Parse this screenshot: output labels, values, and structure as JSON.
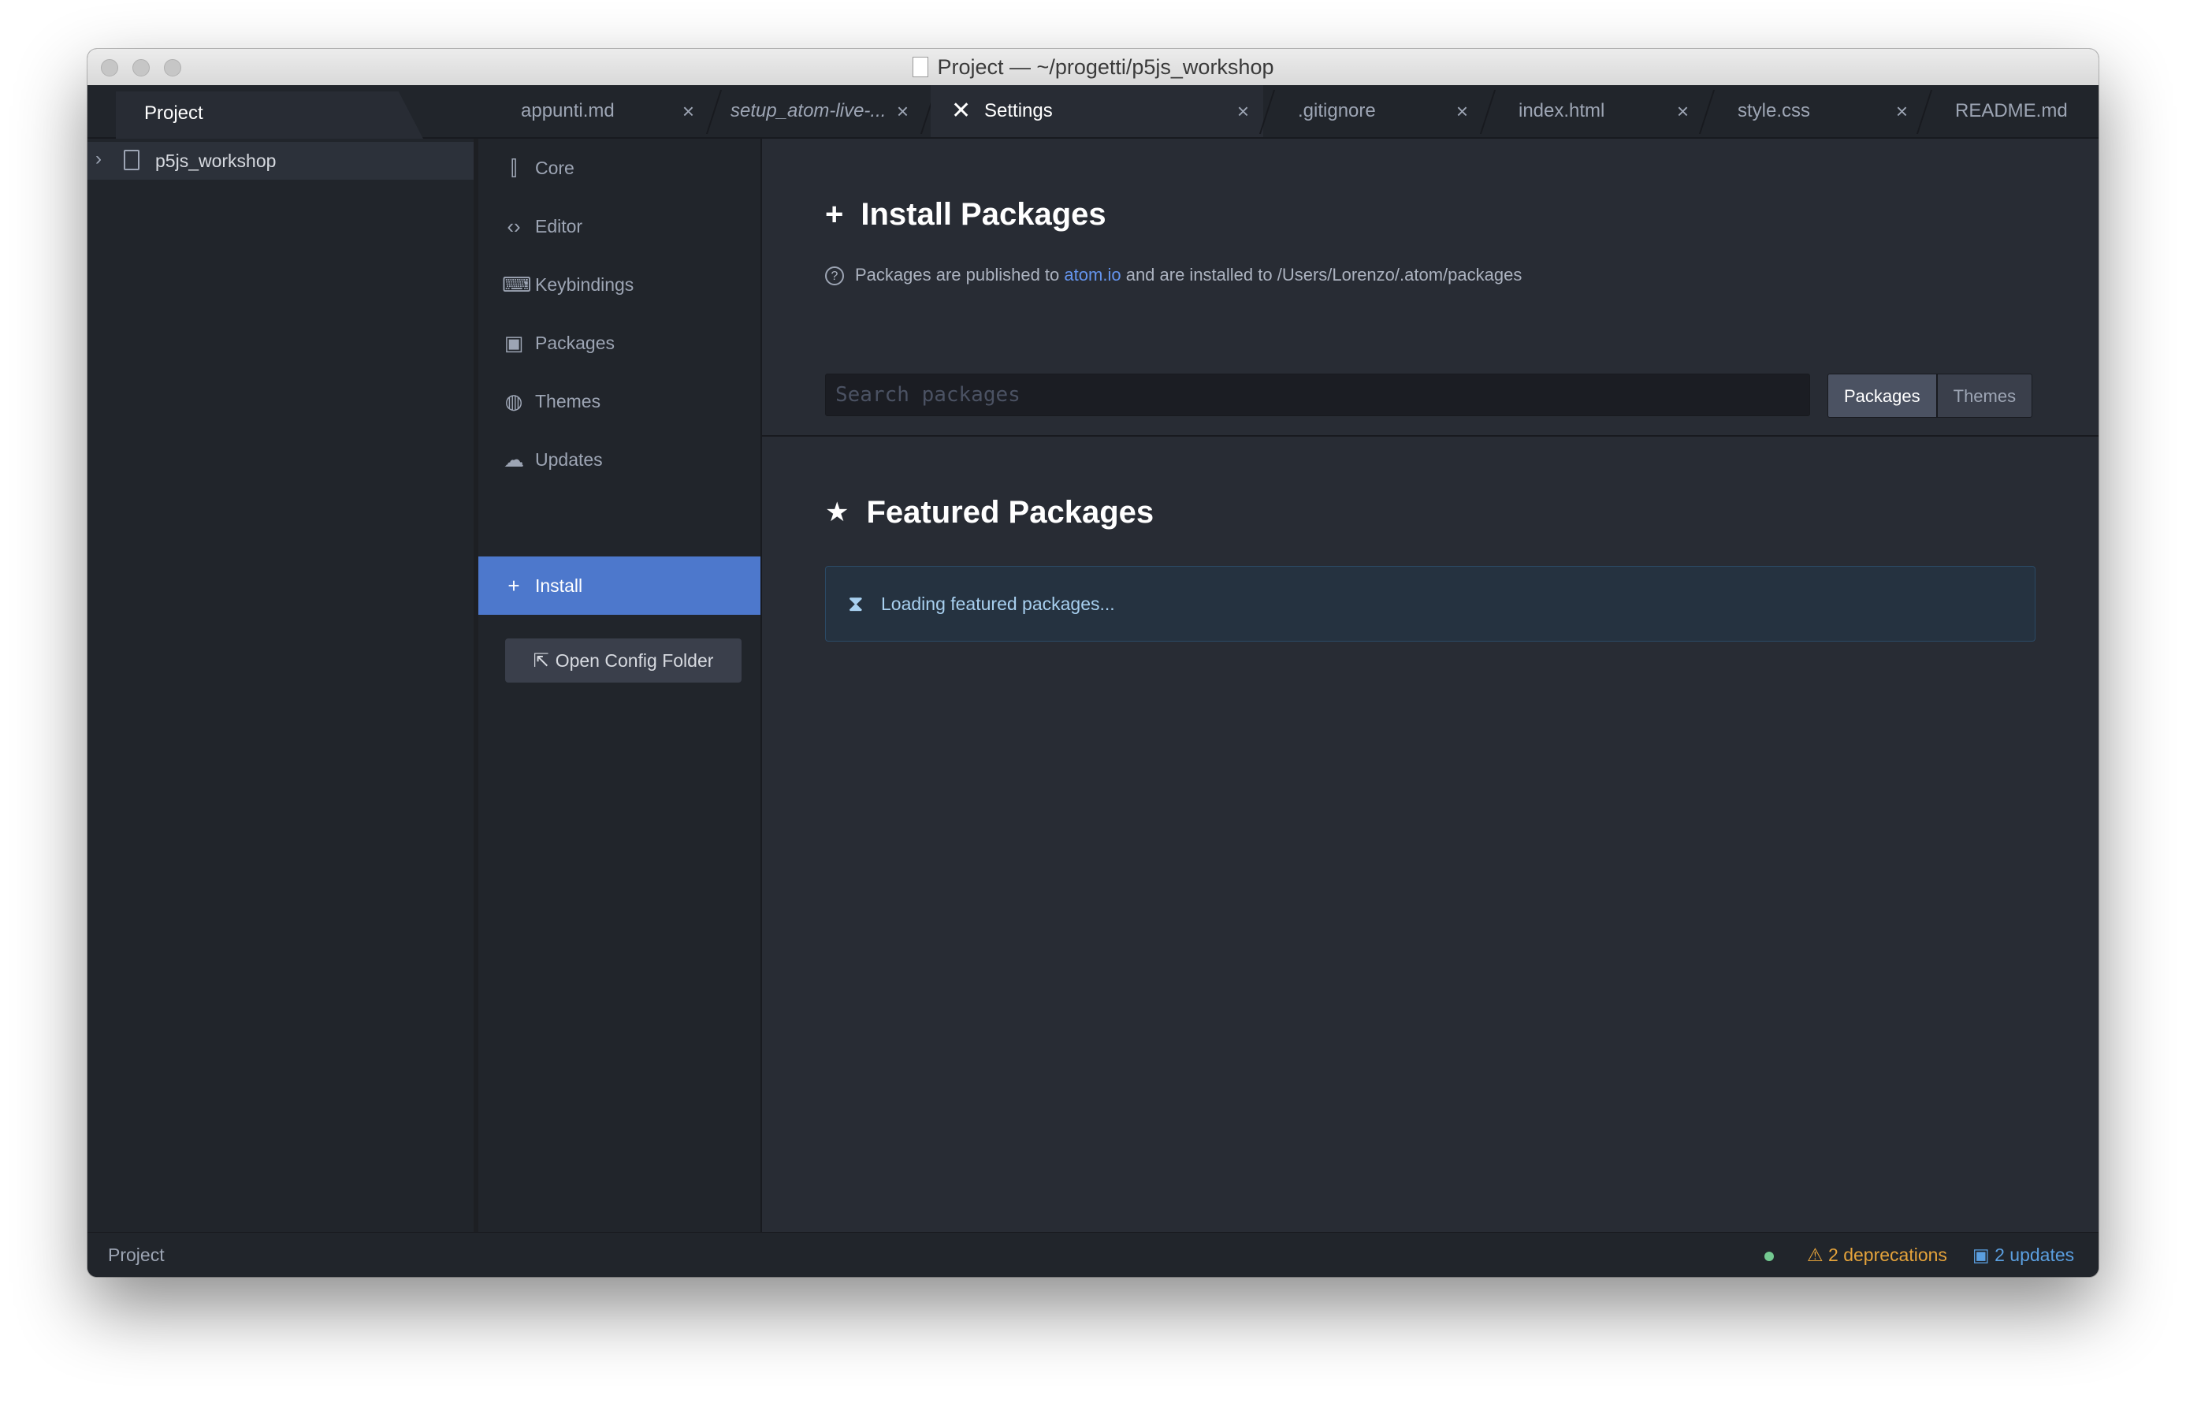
{
  "window": {
    "title": "Project — ~/progetti/p5js_workshop"
  },
  "tabs": {
    "project_pane_label": "Project",
    "items": [
      {
        "label": "appunti.md",
        "close": "×"
      },
      {
        "label": "setup_atom-live-...",
        "close": "×"
      },
      {
        "label": "Settings",
        "close": "×"
      },
      {
        "label": ".gitignore",
        "close": "×"
      },
      {
        "label": "index.html",
        "close": "×"
      },
      {
        "label": "style.css",
        "close": "×"
      },
      {
        "label": "README.md",
        "close": "×"
      }
    ]
  },
  "tree": {
    "root": {
      "label": "p5js_workshop",
      "icon": "repo-icon"
    }
  },
  "settings_nav": {
    "items": [
      {
        "label": "Core",
        "icon": "sliders-icon"
      },
      {
        "label": "Editor",
        "icon": "code-icon"
      },
      {
        "label": "Keybindings",
        "icon": "keyboard-icon"
      },
      {
        "label": "Packages",
        "icon": "package-icon"
      },
      {
        "label": "Themes",
        "icon": "paintcan-icon"
      },
      {
        "label": "Updates",
        "icon": "cloud-download-icon"
      },
      {
        "label": "Install",
        "icon": "plus-icon"
      }
    ],
    "active": "Install",
    "open_config_label": "Open Config Folder"
  },
  "install": {
    "title": "Install Packages",
    "info_prefix": "Packages are published to",
    "info_link": "atom.io",
    "info_suffix": "and are installed to /Users/Lorenzo/.atom/packages",
    "search_placeholder": "Search packages",
    "toggle_packages": "Packages",
    "toggle_themes": "Themes",
    "selected_toggle": "Packages"
  },
  "featured": {
    "title": "Featured Packages",
    "loading_text": "Loading featured packages..."
  },
  "statusbar": {
    "left": "Project",
    "deprecations": "2 deprecations",
    "updates": "2 updates"
  },
  "colors": {
    "accent": "#4d78cc",
    "warning": "#e5a33b",
    "info": "#5b9fe0",
    "ok": "#73c990"
  }
}
